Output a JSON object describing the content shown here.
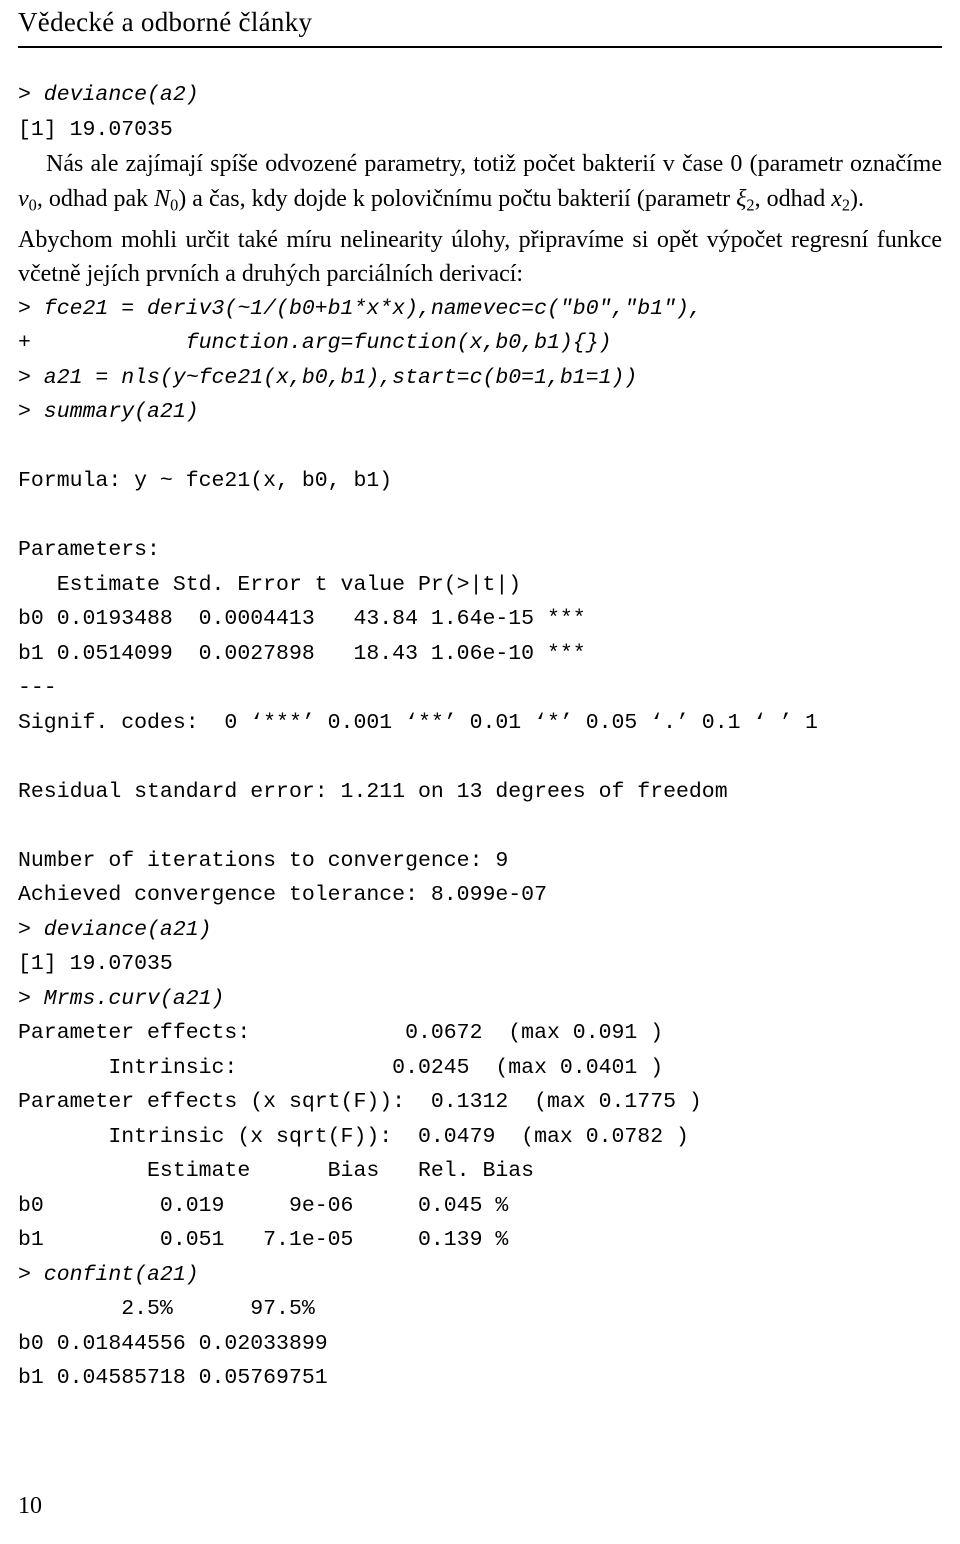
{
  "header": {
    "title": "Vědecké a odborné články"
  },
  "code_block_1": [
    "> deviance(a2)",
    "[1] 19.07035"
  ],
  "paragraph_1": {
    "line1_pre": "Nás ale zajímají spíše odvozené parametry, totiž počet bakterií v čase 0 (parametr označíme ",
    "nu": "ν",
    "nu_sub": "0",
    "line1_mid": ", odhad pak ",
    "N": "N",
    "N_sub": "0",
    "line1_mid2": ") a čas, kdy dojde k polovičnímu počtu bakterií (parametr ",
    "xi": "ξ",
    "xi_sub": "2",
    "line1_mid3": ", odhad ",
    "x": "x",
    "x_sub": "2",
    "line1_end": ")."
  },
  "paragraph_2": {
    "text": "Abychom mohli určit také míru nelinearity úlohy, připravíme si opět výpočet regresní funkce včetně jejích prvních a druhých parciálních derivací:"
  },
  "code_block_2": [
    "> fce21 = deriv3(~1/(b0+b1*x*x),namevec=c(\"b0\",\"b1\"),",
    "+            function.arg=function(x,b0,b1){})",
    "> a21 = nls(y~fce21(x,b0,b1),start=c(b0=1,b1=1))",
    "> summary(a21)"
  ],
  "code_block_3": [
    "Formula: y ~ fce21(x, b0, b1)",
    "",
    "Parameters:",
    "   Estimate Std. Error t value Pr(>|t|)",
    "b0 0.0193488  0.0004413   43.84 1.64e-15 ***",
    "b1 0.0514099  0.0027898   18.43 1.06e-10 ***",
    "---",
    "Signif. codes:  0 ‘***’ 0.001 ‘**’ 0.01 ‘*’ 0.05 ‘.’ 0.1 ‘ ’ 1",
    "",
    "Residual standard error: 1.211 on 13 degrees of freedom",
    "",
    "Number of iterations to convergence: 9",
    "Achieved convergence tolerance: 8.099e-07"
  ],
  "code_block_4": [
    "> deviance(a21)",
    "[1] 19.07035",
    "> Mrms.curv(a21)"
  ],
  "code_block_5": [
    "Parameter effects:            0.0672  (max 0.091 )",
    "       Intrinsic:            0.0245  (max 0.0401 )",
    "Parameter effects (x sqrt(F)):  0.1312  (max 0.1775 )",
    "       Intrinsic (x sqrt(F)):  0.0479  (max 0.0782 )",
    "          Estimate      Bias   Rel. Bias",
    "b0         0.019     9e-06     0.045 %",
    "b1         0.051   7.1e-05     0.139 %"
  ],
  "code_block_6": [
    "> confint(a21)"
  ],
  "code_block_7": [
    "        2.5%      97.5%",
    "b0 0.01844556 0.02033899",
    "b1 0.04585718 0.05769751"
  ],
  "folio": {
    "page_number": "10"
  }
}
